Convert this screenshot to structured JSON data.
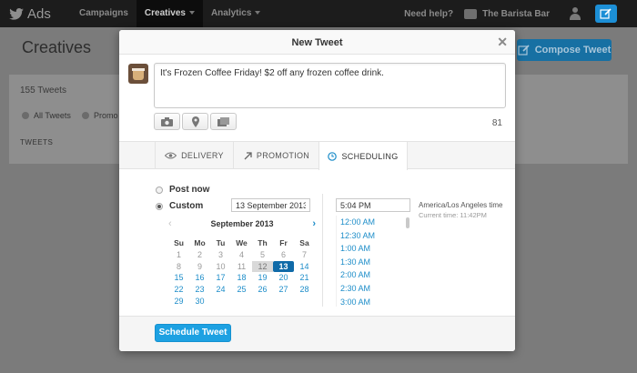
{
  "app": {
    "title": "Ads"
  },
  "nav": [
    {
      "label": "Campaigns",
      "active": false,
      "caret": false
    },
    {
      "label": "Creatives",
      "active": true,
      "caret": true
    },
    {
      "label": "Analytics",
      "active": false,
      "caret": true
    }
  ],
  "topright": {
    "help": "Need help?",
    "account": "The Barista Bar"
  },
  "background": {
    "title": "Creatives",
    "compose_label": "Compose Tweet",
    "count": "155 Tweets",
    "filter_all": "All Tweets",
    "filter_promoted": "Promo",
    "tweets_header": "TWEETS"
  },
  "modal": {
    "title": "New Tweet",
    "close": "✕",
    "tweet_text": "It's Frozen Coffee Friday! $2 off any frozen coffee drink.",
    "char_count": "81",
    "tabs": {
      "delivery": "DELIVERY",
      "promotion": "PROMOTION",
      "scheduling": "SCHEDULING"
    },
    "options": {
      "post_now": "Post now",
      "custom": "Custom"
    },
    "date_value": "13 September 2013",
    "calendar": {
      "month": "September 2013",
      "prev": "‹",
      "next": "›",
      "days": [
        "Su",
        "Mo",
        "Tu",
        "We",
        "Th",
        "Fr",
        "Sa"
      ],
      "weeks": [
        [
          "1",
          "2",
          "3",
          "4",
          "5",
          "6",
          "7"
        ],
        [
          "8",
          "9",
          "10",
          "11",
          "12",
          "13",
          "14"
        ],
        [
          "15",
          "16",
          "17",
          "18",
          "19",
          "20",
          "21"
        ],
        [
          "22",
          "23",
          "24",
          "25",
          "26",
          "27",
          "28"
        ],
        [
          "29",
          "30",
          "",
          "",
          "",
          "",
          ""
        ]
      ],
      "today": "12",
      "selected": "13"
    },
    "time_value": "5:04 PM",
    "timezone": "America/Los Angeles time",
    "current_time": "Current time: 11:42PM",
    "times": [
      "12:00 AM",
      "12:30 AM",
      "1:00 AM",
      "1:30 AM",
      "2:00 AM",
      "2:30 AM",
      "3:00 AM"
    ],
    "schedule_label": "Schedule Tweet"
  },
  "colors": {
    "accent": "#1da1e2",
    "selected_day": "#0f6aa8",
    "link": "#1d8dc9"
  }
}
